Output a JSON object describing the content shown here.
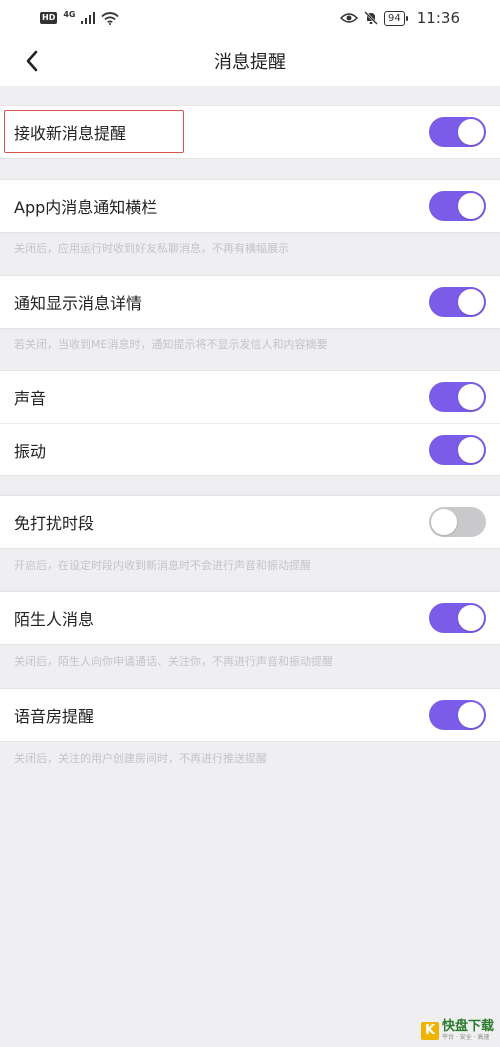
{
  "status_bar": {
    "hd": "HD",
    "network": "4G",
    "battery": "94",
    "time": "11:36"
  },
  "header": {
    "title": "消息提醒",
    "back_icon": "chevron-left-icon"
  },
  "accent_color": "#7b5ce8",
  "toggle_off_color": "#c9c9cc",
  "settings": {
    "receive_new": {
      "label": "接收新消息提醒",
      "enabled": true
    },
    "app_banner": {
      "label": "App内消息通知横栏",
      "enabled": true,
      "desc": "关闭后，应用运行时收到好友私聊消息，不再有横幅展示"
    },
    "show_detail": {
      "label": "通知显示消息详情",
      "enabled": true,
      "desc": "若关闭，当收到ME消息时，通知提示将不显示发信人和内容摘要"
    },
    "sound": {
      "label": "声音",
      "enabled": true
    },
    "vibrate": {
      "label": "振动",
      "enabled": true
    },
    "dnd": {
      "label": "免打扰时段",
      "enabled": false,
      "desc": "开启后，在设定时段内收到新消息时不会进行声音和振动提醒"
    },
    "stranger": {
      "label": "陌生人消息",
      "enabled": true,
      "desc": "关闭后，陌生人向你申请通话、关注你，不再进行声音和振动提醒"
    },
    "voice_room": {
      "label": "语音房提醒",
      "enabled": true,
      "desc": "关闭后，关注的用户创建房间时，不再进行推送提醒"
    }
  },
  "watermark": {
    "logo_letter": "K",
    "name": "快盘下载",
    "sub": "平台 · 安全 · 高速"
  }
}
